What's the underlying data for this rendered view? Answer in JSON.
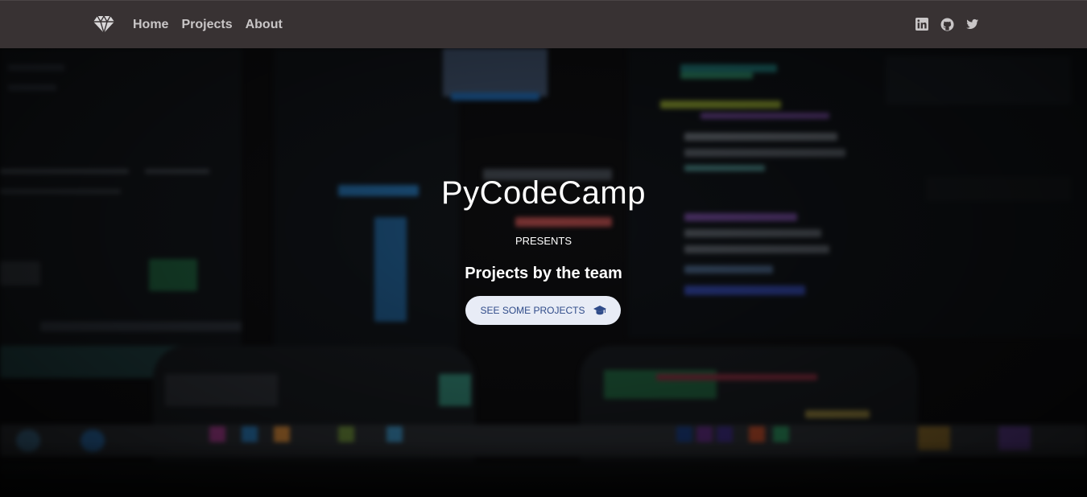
{
  "navbar": {
    "brand_icon": "diamond-icon",
    "links": [
      {
        "label": "Home"
      },
      {
        "label": "Projects"
      },
      {
        "label": "About"
      }
    ],
    "social": [
      {
        "name": "linkedin-icon"
      },
      {
        "name": "github-icon"
      },
      {
        "name": "twitter-icon"
      }
    ]
  },
  "hero": {
    "title": "PyCodeCamp",
    "presents": "PRESENTS",
    "subtitle": "Projects by the team",
    "cta": {
      "label": "SEE SOME PROJECTS",
      "icon": "graduation-cap-icon"
    }
  },
  "colors": {
    "navbar_bg": "#383233",
    "nav_text": "#c9c6c7",
    "cta_bg": "#e8ecf6",
    "cta_text": "#2f4b89"
  }
}
